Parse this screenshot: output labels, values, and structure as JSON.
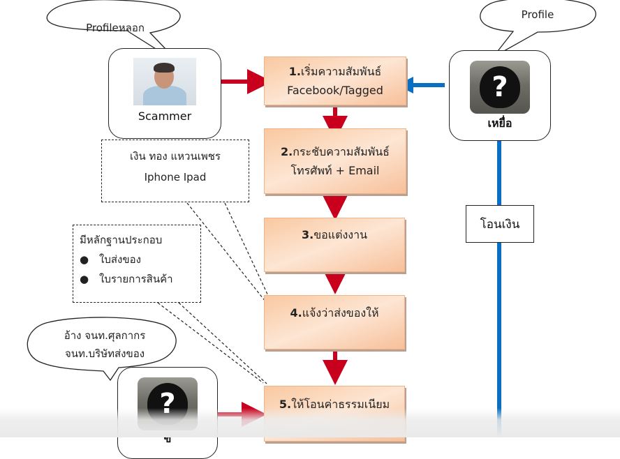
{
  "colors": {
    "scammer_arrow": "#c8001e",
    "victim_arrow": "#0a6fc2",
    "flow_box_fill": "#fbd3b4"
  },
  "scammer": {
    "bubble_text": "Profileหลอก",
    "label": "Scammer",
    "image": "scammer-photo"
  },
  "victim": {
    "bubble_text": "Profile",
    "label": "เหยื่อ",
    "icon": "question-mark-icon"
  },
  "accomplice": {
    "bubble_line1": "อ้าง จนท.ศุลกากร",
    "bubble_line2": "จนท.บริษัทส่งของ",
    "label": "ข",
    "icon": "question-mark-icon"
  },
  "steps": [
    {
      "num": "1.",
      "line1": "เริ่มความสัมพันธ์",
      "line2": "Facebook/Tagged"
    },
    {
      "num": "2.",
      "line1": "กระชับความสัมพันธ์",
      "line2": "โทรศัพท์ + Email"
    },
    {
      "num": "3.",
      "line1": "ขอแต่งงาน",
      "line2": ""
    },
    {
      "num": "4.",
      "line1": "แจ้งว่าส่งของให้",
      "line2": ""
    },
    {
      "num": "5.",
      "line1": "ให้โอนค่าธรรมเนียม",
      "line2": ""
    }
  ],
  "gifts_note": {
    "line1": "เงิน ทอง แหวนเพชร",
    "line2": "Iphone  Ipad"
  },
  "evidence_note": {
    "title": "มีหลักฐานประกอบ",
    "bullets": [
      "ใบส่งของ",
      "ใบรายการสินค้า"
    ]
  },
  "transfer_label": "โอนเงิน"
}
